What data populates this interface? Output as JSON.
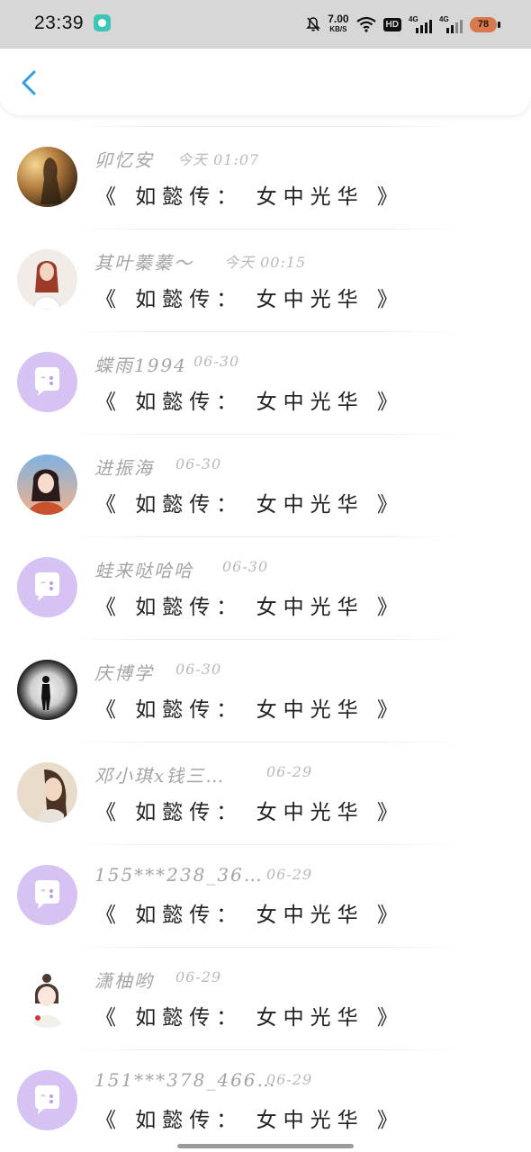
{
  "status_bar": {
    "time": "23:39",
    "net_speed_value": "7.00",
    "net_speed_unit": "KB/S",
    "hd_label": "HD",
    "sim1_label": "4G",
    "sim2_label": "4G",
    "battery_level": "78",
    "icons": [
      "app-notification-icon",
      "mute-bell-icon",
      "wifi-icon",
      "hd-icon",
      "signal-icon",
      "signal-icon",
      "battery-icon"
    ]
  },
  "header": {
    "back_icon": "chevron-left-icon",
    "accent_color": "#2f9ee8"
  },
  "messages": [
    {
      "name": "卯忆安",
      "time": "今天 01:07",
      "text": "《 如懿传：  女中光华 》",
      "avatar": "photo-dusk-girl"
    },
    {
      "name": "其叶蓁蓁～",
      "time": "今天 00:15",
      "text": "《 如懿传：  女中光华 》",
      "avatar": "photo-red-hair-girl"
    },
    {
      "name": "蝶雨1994",
      "time": "06-30",
      "text": "《 如懿传：  女中光华 》",
      "avatar": "default-chat-bubble"
    },
    {
      "name": "进振海",
      "time": "06-30",
      "text": "《 如懿传：  女中光华 》",
      "avatar": "photo-anime-girl"
    },
    {
      "name": "蛙来哒哈哈",
      "time": "06-30",
      "text": "《 如懿传：  女中光华 》",
      "avatar": "default-chat-bubble"
    },
    {
      "name": "庆博学",
      "time": "06-30",
      "text": "《 如懿传：  女中光华 》",
      "avatar": "photo-silhouette-tunnel"
    },
    {
      "name": "邓小琪x钱三…",
      "time": "06-29",
      "text": "《 如懿传：  女中光华 》",
      "avatar": "photo-woman-portrait"
    },
    {
      "name": "155***238_36…",
      "time": "06-29",
      "text": "《 如懿传：  女中光华 》",
      "avatar": "default-chat-bubble"
    },
    {
      "name": "潇柚哟",
      "time": "06-29",
      "text": "《 如懿传：  女中光华 》",
      "avatar": "photo-cartoon-girl"
    },
    {
      "name": "151***378_466…",
      "time": "06-29",
      "text": "《 如懿传：  女中光华 》",
      "avatar": "default-chat-bubble"
    }
  ],
  "colors": {
    "default_avatar_bg": "#d6c3f3",
    "name_text": "#a4a4a4",
    "message_text": "#222222"
  }
}
